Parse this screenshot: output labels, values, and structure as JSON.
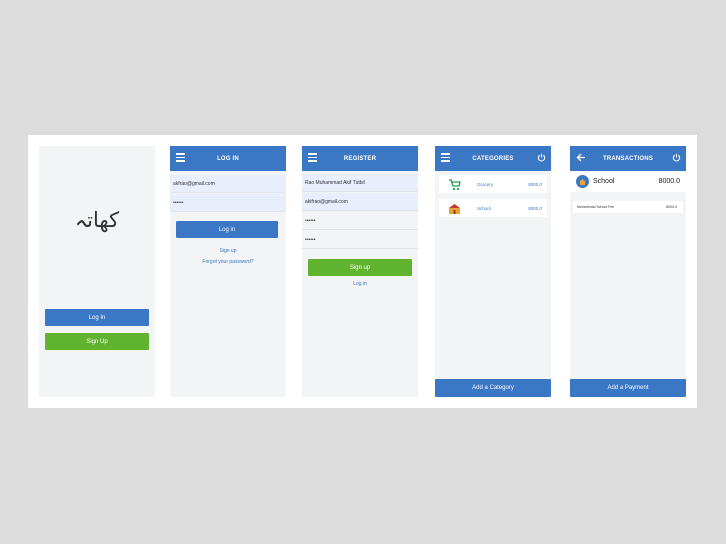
{
  "welcome": {
    "logo_text": "کھاتہ",
    "login_label": "Log In",
    "signup_label": "Sign Up"
  },
  "login": {
    "title": "LOG IN",
    "email_value": "akfrao@gmail.com",
    "password_value": "••••••",
    "login_button": "Log in",
    "signup_link": "Sign up",
    "forgot_link": "Forgot your password?"
  },
  "register": {
    "title": "REGISTER",
    "name_value": "Rao Muhammad Akif Tutbil",
    "email_value": "akifrao@gmail.com",
    "password_value": "••••••",
    "confirm_value": "••••••",
    "signup_button": "Sign up",
    "login_link": "Log in"
  },
  "categories": {
    "title": "CATEGORIES",
    "items": [
      {
        "name": "Grocery",
        "amount": "8000.0",
        "icon": "cart-icon"
      },
      {
        "name": "School",
        "amount": "8000.0",
        "icon": "school-icon"
      }
    ],
    "add_button": "Add a Category"
  },
  "transactions": {
    "title": "TRANSACTIONS",
    "category_name": "School",
    "category_total": "8000.0",
    "rows": [
      {
        "description": "Muhammad School Fee",
        "amount": "8000.0"
      }
    ],
    "add_button": "Add a Payment"
  },
  "colors": {
    "primary": "#3a77c4",
    "accent": "#5fb32e",
    "screen_bg": "#f3f4f6"
  }
}
